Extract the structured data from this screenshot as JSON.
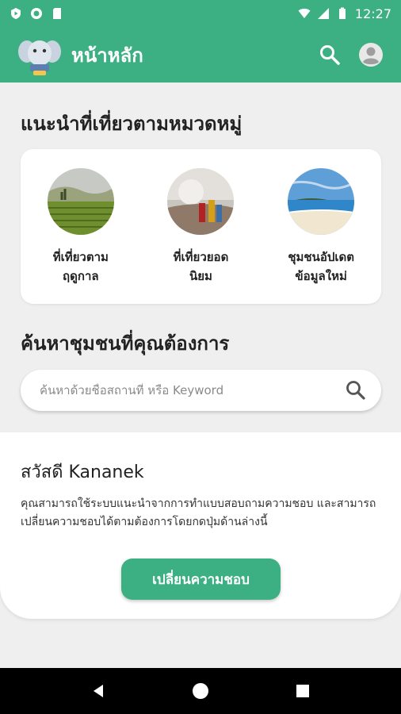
{
  "status_bar": {
    "time": "12:27"
  },
  "app_bar": {
    "title": "หน้าหลัก"
  },
  "categories_section": {
    "title": "แนะนำที่เที่ยวตามหมวดหมู่",
    "items": [
      {
        "label": "ที่เที่ยวตาม\nฤดูกาล",
        "icon": "tea-plantation-photo"
      },
      {
        "label": "ที่เที่ยวยอด\nนิยม",
        "icon": "festival-photo"
      },
      {
        "label": "ชุมชนอัปเดต\nข้อมูลใหม่",
        "icon": "beach-photo"
      }
    ]
  },
  "search_section": {
    "title": "ค้นหาชุมชนที่คุณต้องการ",
    "placeholder": "ค้นหาด้วยชื่อสถานที่ หรือ Keyword"
  },
  "greeting": {
    "title": "สวัสดี Kananek",
    "text": "คุณสามารถใช้ระบบแนะนำจากการทำแบบสอบถามความชอบ และสามารถเปลี่ยนความชอบได้ตามต้องการโดยกดปุ่มด้านล่างนี้",
    "button": "เปลี่ยนความชอบ"
  },
  "colors": {
    "primary": "#3cb083",
    "background": "#efefef"
  }
}
